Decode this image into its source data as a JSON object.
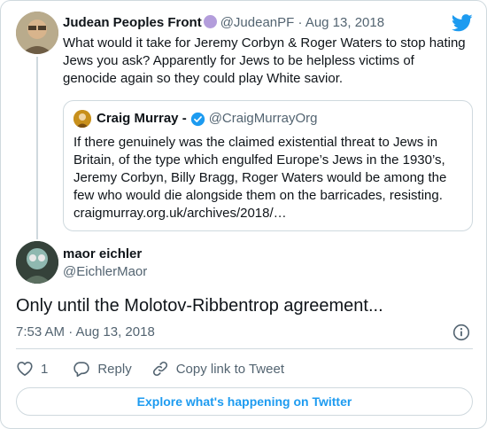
{
  "parent_tweet": {
    "name": "Judean Peoples Front",
    "handle": "@JudeanPF",
    "separator": "·",
    "date": "Aug 13, 2018",
    "text": "What would it take for Jeremy Corbyn & Roger Waters to stop hating Jews you ask? Apparently for Jews to be helpless victims of genocide again so they could play White savior.",
    "badge_color": "#b39ddb"
  },
  "quoted_tweet": {
    "name": "Craig Murray -",
    "handle": "@CraigMurrayOrg",
    "text": "If there genuinely was the claimed existential threat to Jews in Britain, of the type which engulfed Europe’s Jews in the 1930’s, Jeremy Corbyn, Billy Bragg, Roger Waters would be among the few who would die alongside them on the barricades, resisting. craigmurray.org.uk/archives/2018/…"
  },
  "main_tweet": {
    "name": "maor eichler",
    "handle": "@EichlerMaor",
    "text": "Only until the Molotov-Ribbentrop agreement...",
    "timestamp": "7:53 AM · Aug 13, 2018"
  },
  "actions": {
    "like_count": "1",
    "reply_label": "Reply",
    "copy_link_label": "Copy link to Tweet"
  },
  "explore_label": "Explore what's happening on Twitter",
  "colors": {
    "accent": "#1d9bf0",
    "text": "#0f1419",
    "muted": "#536471",
    "border": "#cfd9de"
  },
  "icons": [
    "twitter-bird-icon",
    "verified-badge-icon",
    "info-icon",
    "heart-icon",
    "reply-bubble-icon",
    "link-icon"
  ]
}
